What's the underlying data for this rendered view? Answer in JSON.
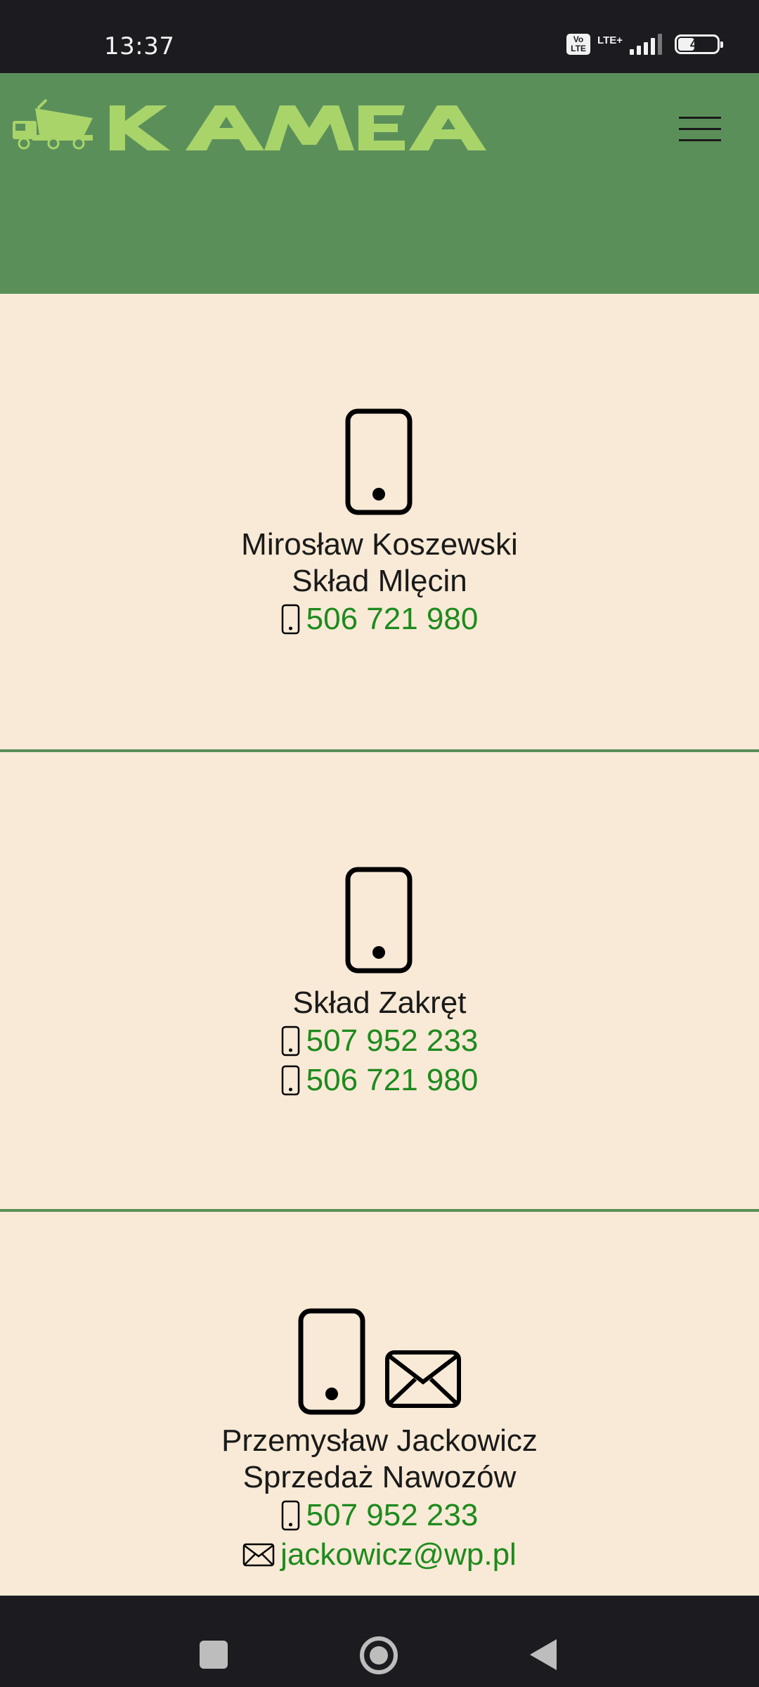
{
  "status_bar": {
    "time": "13:37",
    "volte_label": "Vo\nLTE",
    "network_label": "LTE+",
    "battery_level": "41"
  },
  "header": {
    "logo_text": "KAMEA",
    "background_color": "#5b8f5a",
    "logo_color": "#a8d46a",
    "menu_icon": "hamburger-menu-icon"
  },
  "contacts": [
    {
      "icons": [
        "phone-icon"
      ],
      "lines": [
        "Mirosław Koszewski",
        "Skład Mlęcin"
      ],
      "phones": [
        "506 721 980"
      ],
      "emails": []
    },
    {
      "icons": [
        "phone-icon"
      ],
      "lines": [
        "Skład Zakręt"
      ],
      "phones": [
        "507 952 233",
        "506 721 980"
      ],
      "emails": []
    },
    {
      "icons": [
        "phone-icon",
        "envelope-icon"
      ],
      "lines": [
        "Przemysław Jackowicz",
        "Sprzedaż Nawozów"
      ],
      "phones": [
        "507 952 233"
      ],
      "emails": [
        "jackowicz@wp.pl"
      ]
    }
  ],
  "colors": {
    "page_background": "#f8ead6",
    "link_green": "#1e8a1e",
    "divider_green": "#5b8f5a"
  },
  "nav_bar": {
    "icons": [
      "recents-square-icon",
      "home-circle-icon",
      "back-triangle-icon"
    ]
  }
}
